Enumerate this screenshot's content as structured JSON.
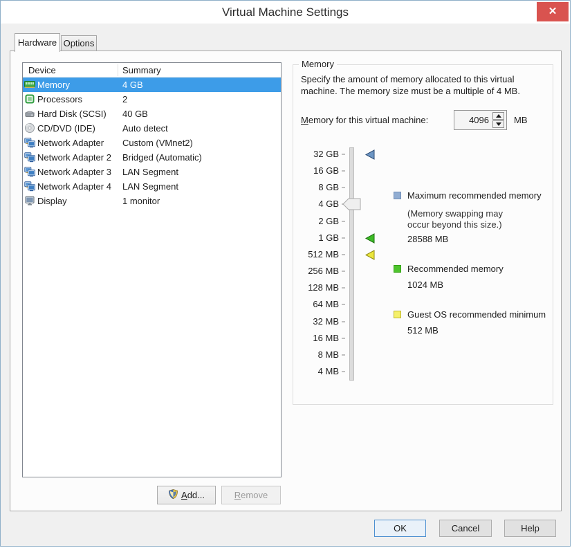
{
  "window": {
    "title": "Virtual Machine Settings",
    "close_glyph": "✕"
  },
  "tabs": [
    {
      "label": "Hardware",
      "active": true
    },
    {
      "label": "Options",
      "active": false
    }
  ],
  "device_table": {
    "columns": [
      "Device",
      "Summary"
    ],
    "rows": [
      {
        "icon": "memory-icon",
        "name": "Memory",
        "summary": "4 GB",
        "selected": true
      },
      {
        "icon": "processor-icon",
        "name": "Processors",
        "summary": "2",
        "selected": false
      },
      {
        "icon": "hard-disk-icon",
        "name": "Hard Disk (SCSI)",
        "summary": "40 GB",
        "selected": false
      },
      {
        "icon": "cd-dvd-icon",
        "name": "CD/DVD (IDE)",
        "summary": "Auto detect",
        "selected": false
      },
      {
        "icon": "network-adapter-icon",
        "name": "Network Adapter",
        "summary": "Custom (VMnet2)",
        "selected": false
      },
      {
        "icon": "network-adapter-icon",
        "name": "Network Adapter 2",
        "summary": "Bridged (Automatic)",
        "selected": false
      },
      {
        "icon": "network-adapter-icon",
        "name": "Network Adapter 3",
        "summary": "LAN Segment",
        "selected": false
      },
      {
        "icon": "network-adapter-icon",
        "name": "Network Adapter 4",
        "summary": "LAN Segment",
        "selected": false
      },
      {
        "icon": "display-icon",
        "name": "Display",
        "summary": "1 monitor",
        "selected": false
      }
    ]
  },
  "device_actions": {
    "add_label": "Add...",
    "remove_label": "Remove"
  },
  "memory_panel": {
    "group_label": "Memory",
    "description": "Specify the amount of memory allocated to this virtual machine. The memory size must be a multiple of 4 MB.",
    "field_label": "Memory for this virtual machine:",
    "spinner_value": "4096",
    "unit": "MB",
    "slider": {
      "scale_labels": [
        "32 GB",
        "16 GB",
        "8 GB",
        "4 GB",
        "2 GB",
        "1 GB",
        "512 MB",
        "256 MB",
        "128 MB",
        "64 MB",
        "32 MB",
        "16 MB",
        "8 MB",
        "4 MB"
      ],
      "handle_at_label": "4 GB",
      "markers": [
        {
          "name": "maximum-memory-marker-icon",
          "fill": "#6d96c4",
          "stroke": "#2e4d75",
          "at_label": "32 GB"
        },
        {
          "name": "recommended-memory-marker-icon",
          "fill": "#3dbb26",
          "stroke": "#1c6f10",
          "at_label": "1 GB"
        },
        {
          "name": "minimum-memory-marker-icon",
          "fill": "#ece73d",
          "stroke": "#8f8a12",
          "at_label": "512 MB"
        }
      ]
    },
    "legend": [
      {
        "name": "maximum-recommended-memory",
        "swatch_fill": "#91add2",
        "swatch_border": "#6e8cb5",
        "title": "Maximum recommended memory",
        "note_lines": [
          "(Memory swapping may",
          "occur beyond this size.)"
        ],
        "value": "28588 MB"
      },
      {
        "name": "recommended-memory",
        "swatch_fill": "#4ec42d",
        "swatch_border": "#35a215",
        "title": "Recommended memory",
        "note_lines": [],
        "value": "1024 MB"
      },
      {
        "name": "guest-os-recommended-minimum",
        "swatch_fill": "#f5f06b",
        "swatch_border": "#bdb52c",
        "title": "Guest OS recommended minimum",
        "note_lines": [],
        "value": "512 MB"
      }
    ]
  },
  "footer": {
    "ok_label": "OK",
    "cancel_label": "Cancel",
    "help_label": "Help"
  }
}
